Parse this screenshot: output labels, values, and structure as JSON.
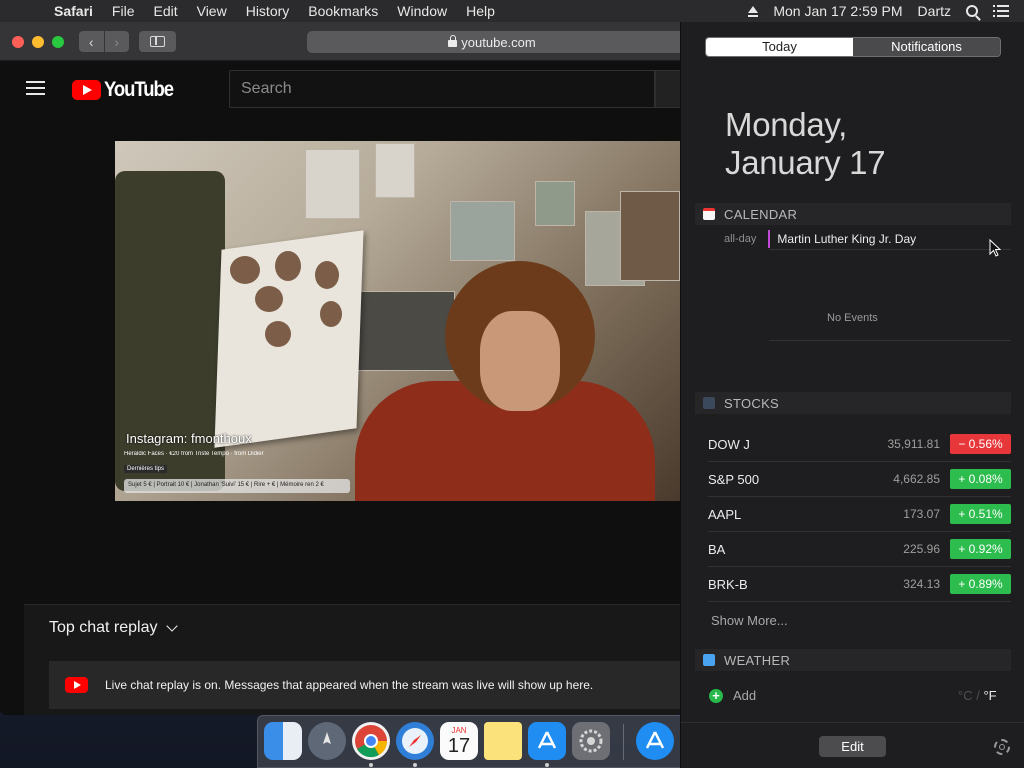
{
  "menubar": {
    "app_name": "Safari",
    "items": [
      "File",
      "Edit",
      "View",
      "History",
      "Bookmarks",
      "Window",
      "Help"
    ],
    "datetime": "Mon Jan 17  2:59 PM",
    "user": "Dartz"
  },
  "safari": {
    "url": "youtube.com",
    "back_glyph": "‹",
    "forward_glyph": "›"
  },
  "youtube": {
    "logo_text": "YouTube",
    "search_placeholder": "Search",
    "video_overlay": "Instagram: fmonthoux",
    "ticker_line1": "Heraldic Faces · €20 from Triste Tempo · from Didier",
    "ticker_line2": "Dernières tips",
    "ticker_line3": "Sujet 5 € | Portrait 10 € | Jonathan 'Suivi' 15 € | Rire + € | Mémoire ren 2 €",
    "chat_title": "Top chat replay",
    "chat_message": "Live chat replay is on. Messages that appeared when the stream was live will show up here."
  },
  "notification_center": {
    "tabs": [
      {
        "label": "Today",
        "active": true
      },
      {
        "label": "Notifications",
        "active": false
      }
    ],
    "day_line1": "Monday,",
    "day_line2": "January 17",
    "calendar": {
      "heading": "CALENDAR",
      "allday_label": "all-day",
      "event": "Martin Luther King Jr. Day",
      "empty": "No Events"
    },
    "stocks": {
      "heading": "STOCKS",
      "rows": [
        {
          "symbol": "DOW J",
          "price": "35,911.81",
          "change": "− 0.56%",
          "color": "#e8373b"
        },
        {
          "symbol": "S&P 500",
          "price": "4,662.85",
          "change": "+ 0.08%",
          "color": "#2dbc4e"
        },
        {
          "symbol": "AAPL",
          "price": "173.07",
          "change": "+ 0.51%",
          "color": "#2dbc4e"
        },
        {
          "symbol": "BA",
          "price": "225.96",
          "change": "+ 0.92%",
          "color": "#2dbc4e"
        },
        {
          "symbol": "BRK-B",
          "price": "324.13",
          "change": "+ 0.89%",
          "color": "#2dbc4e"
        }
      ],
      "show_more": "Show More..."
    },
    "weather": {
      "heading": "WEATHER",
      "add_label": "Add",
      "unit_c": "°C",
      "unit_sep": " / ",
      "unit_f": "°F"
    },
    "edit_label": "Edit"
  },
  "dock": {
    "calendar_month": "JAN",
    "calendar_day": "17"
  },
  "colors": {
    "youtube_red": "#ff0000",
    "stock_down": "#e8373b",
    "stock_up": "#2dbc4e",
    "calendar_accent": "#c14bd6"
  }
}
